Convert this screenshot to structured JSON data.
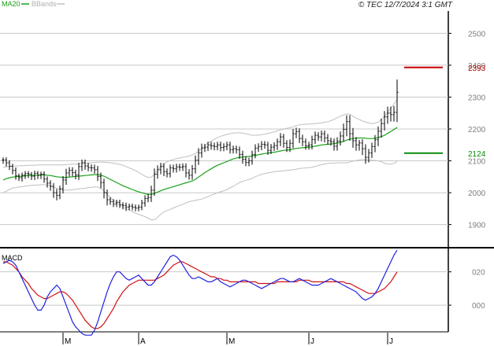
{
  "legend": {
    "ma_label": "MA20",
    "bands_label": "BBands"
  },
  "copyright": "© TEC 12/7/2024 3:1 GMT",
  "macd_title": "MACD",
  "colors": {
    "price_bar": "#000000",
    "ma20": "#1aa01a",
    "bbands": "#c0c0c0",
    "macd_line": "#1f22e0",
    "signal_line": "#d01010",
    "resistance": "#cc0000",
    "support": "#0a8a0a",
    "grid": "#c8c8c8"
  },
  "chart_data": [
    {
      "type": "ohlc",
      "title": "",
      "ylim": [
        1830,
        2570
      ],
      "y_ticks": [
        "2500",
        "2400",
        "2300",
        "2200",
        "2100",
        "2000",
        "1900"
      ],
      "x_labels": [
        "M",
        "A",
        "M",
        "J",
        "J"
      ],
      "x_label_index": [
        19,
        43,
        71,
        97,
        122
      ],
      "levels": [
        {
          "name": "resistance",
          "value": 2393,
          "label": "2393"
        },
        {
          "name": "support",
          "value": 2124,
          "label": "2124"
        }
      ],
      "close": [
        2103,
        2094,
        2083,
        2070,
        2053,
        2047,
        2055,
        2060,
        2058,
        2052,
        2061,
        2055,
        2058,
        2043,
        2030,
        2020,
        2000,
        1992,
        2012,
        2040,
        2062,
        2070,
        2063,
        2056,
        2082,
        2094,
        2084,
        2079,
        2078,
        2072,
        2051,
        2032,
        2000,
        1978,
        1972,
        1965,
        1970,
        1962,
        1960,
        1955,
        1958,
        1955,
        1952,
        1955,
        1968,
        1982,
        1985,
        2008,
        2058,
        2072,
        2082,
        2066,
        2060,
        2078,
        2075,
        2081,
        2080,
        2082,
        2062,
        2055,
        2075,
        2102,
        2125,
        2140,
        2143,
        2150,
        2147,
        2145,
        2150,
        2142,
        2145,
        2150,
        2135,
        2138,
        2135,
        2120,
        2105,
        2095,
        2100,
        2120,
        2140,
        2145,
        2152,
        2150,
        2133,
        2143,
        2148,
        2160,
        2175,
        2155,
        2142,
        2155,
        2185,
        2192,
        2170,
        2160,
        2147,
        2150,
        2167,
        2180,
        2175,
        2185,
        2172,
        2163,
        2160,
        2146,
        2162,
        2178,
        2199,
        2223,
        2185,
        2163,
        2150,
        2156,
        2138,
        2111,
        2125,
        2145,
        2166,
        2193,
        2217,
        2238,
        2250,
        2245,
        2252,
        2315
      ],
      "high_offset": [
        8,
        8,
        8,
        8,
        9,
        7,
        8,
        8,
        8,
        7,
        8,
        7,
        8,
        9,
        8,
        9,
        10,
        12,
        10,
        12,
        13,
        10,
        10,
        9,
        12,
        10,
        10,
        10,
        10,
        10,
        12,
        12,
        12,
        10,
        8,
        8,
        8,
        8,
        8,
        9,
        8,
        8,
        8,
        8,
        10,
        10,
        12,
        14,
        18,
        14,
        12,
        10,
        10,
        10,
        10,
        10,
        10,
        10,
        10,
        12,
        12,
        15,
        15,
        14,
        10,
        10,
        10,
        10,
        10,
        10,
        10,
        10,
        10,
        10,
        10,
        10,
        12,
        10,
        10,
        12,
        12,
        10,
        10,
        10,
        10,
        10,
        10,
        10,
        12,
        10,
        10,
        12,
        15,
        12,
        10,
        12,
        10,
        10,
        12,
        12,
        10,
        10,
        10,
        12,
        10,
        10,
        12,
        14,
        18,
        20,
        20,
        18,
        12,
        10,
        12,
        14,
        12,
        12,
        15,
        15,
        15,
        18,
        20,
        20,
        20,
        40
      ],
      "low_offset": [
        12,
        12,
        12,
        12,
        12,
        10,
        12,
        12,
        12,
        12,
        12,
        12,
        12,
        12,
        14,
        14,
        16,
        16,
        12,
        14,
        15,
        12,
        12,
        14,
        16,
        14,
        12,
        12,
        12,
        12,
        14,
        18,
        18,
        18,
        10,
        10,
        10,
        10,
        12,
        12,
        10,
        10,
        10,
        10,
        10,
        12,
        12,
        14,
        18,
        14,
        14,
        14,
        12,
        12,
        12,
        12,
        12,
        12,
        14,
        14,
        14,
        15,
        15,
        15,
        12,
        12,
        12,
        12,
        12,
        12,
        12,
        12,
        12,
        12,
        12,
        14,
        14,
        12,
        12,
        12,
        12,
        12,
        12,
        12,
        14,
        12,
        12,
        14,
        14,
        14,
        14,
        14,
        15,
        14,
        14,
        14,
        12,
        12,
        14,
        14,
        12,
        14,
        14,
        12,
        12,
        14,
        14,
        14,
        18,
        22,
        22,
        22,
        18,
        18,
        20,
        20,
        16,
        16,
        18,
        20,
        20,
        22,
        22,
        22,
        22,
        30
      ],
      "ma20": [
        2040,
        2044,
        2047,
        2049,
        2050,
        2051,
        2052,
        2053,
        2054,
        2054,
        2055,
        2055,
        2056,
        2056,
        2055,
        2054,
        2052,
        2050,
        2049,
        2048,
        2048,
        2049,
        2050,
        2051,
        2052,
        2053,
        2054,
        2055,
        2056,
        2057,
        2057,
        2055,
        2052,
        2047,
        2042,
        2037,
        2032,
        2027,
        2022,
        2018,
        2014,
        2010,
        2006,
        2003,
        2000,
        1997,
        1995,
        1995,
        1998,
        2002,
        2006,
        2010,
        2013,
        2016,
        2019,
        2022,
        2025,
        2028,
        2031,
        2034,
        2037,
        2042,
        2049,
        2056,
        2063,
        2069,
        2075,
        2081,
        2086,
        2090,
        2094,
        2098,
        2102,
        2106,
        2109,
        2111,
        2112,
        2113,
        2114,
        2115,
        2117,
        2119,
        2121,
        2123,
        2124,
        2126,
        2127,
        2129,
        2131,
        2133,
        2134,
        2135,
        2137,
        2139,
        2140,
        2141,
        2142,
        2143,
        2144,
        2146,
        2148,
        2150,
        2151,
        2152,
        2153,
        2154,
        2156,
        2158,
        2161,
        2165,
        2168,
        2170,
        2171,
        2172,
        2172,
        2171,
        2170,
        2170,
        2171,
        2173,
        2176,
        2180,
        2186,
        2192,
        2198,
        2205
      ],
      "bb_upper": [
        2080,
        2081,
        2082,
        2083,
        2084,
        2084,
        2085,
        2085,
        2086,
        2086,
        2086,
        2087,
        2087,
        2087,
        2087,
        2087,
        2087,
        2087,
        2087,
        2087,
        2088,
        2089,
        2090,
        2090,
        2091,
        2092,
        2093,
        2093,
        2094,
        2095,
        2096,
        2096,
        2096,
        2095,
        2094,
        2093,
        2091,
        2089,
        2086,
        2082,
        2078,
        2074,
        2069,
        2064,
        2058,
        2052,
        2048,
        2049,
        2057,
        2070,
        2082,
        2091,
        2097,
        2101,
        2104,
        2107,
        2109,
        2111,
        2113,
        2115,
        2118,
        2123,
        2130,
        2139,
        2148,
        2156,
        2162,
        2168,
        2173,
        2177,
        2180,
        2183,
        2185,
        2187,
        2188,
        2188,
        2187,
        2185,
        2183,
        2180,
        2180,
        2181,
        2182,
        2184,
        2186,
        2188,
        2191,
        2194,
        2197,
        2200,
        2202,
        2204,
        2207,
        2210,
        2213,
        2214,
        2215,
        2215,
        2216,
        2217,
        2218,
        2219,
        2221,
        2223,
        2226,
        2230,
        2235,
        2240,
        2244,
        2247,
        2246,
        2240,
        2234,
        2230,
        2225,
        2222,
        2219,
        2217,
        2218,
        2222,
        2230,
        2240,
        2252,
        2265,
        2278,
        2292
      ],
      "bb_lower": [
        2000,
        2005,
        2010,
        2015,
        2016,
        2018,
        2019,
        2021,
        2022,
        2023,
        2024,
        2024,
        2025,
        2025,
        2024,
        2022,
        2018,
        2014,
        2011,
        2009,
        2008,
        2008,
        2009,
        2011,
        2012,
        2013,
        2014,
        2016,
        2017,
        2018,
        2018,
        2013,
        2006,
        1995,
        1985,
        1976,
        1969,
        1962,
        1955,
        1950,
        1946,
        1941,
        1936,
        1932,
        1929,
        1925,
        1920,
        1915,
        1915,
        1923,
        1932,
        1940,
        1944,
        1948,
        1952,
        1956,
        1960,
        1964,
        1968,
        1972,
        1974,
        1976,
        1978,
        1980,
        1984,
        1988,
        1992,
        1996,
        2000,
        2003,
        2006,
        2010,
        2015,
        2020,
        2026,
        2032,
        2036,
        2039,
        2042,
        2045,
        2050,
        2054,
        2058,
        2060,
        2062,
        2064,
        2066,
        2067,
        2068,
        2069,
        2070,
        2071,
        2072,
        2074,
        2076,
        2077,
        2078,
        2079,
        2080,
        2082,
        2085,
        2088,
        2090,
        2092,
        2093,
        2093,
        2094,
        2094,
        2094,
        2094,
        2096,
        2099,
        2101,
        2103,
        2104,
        2104,
        2103,
        2102,
        2101,
        2100,
        2097,
        2093,
        2090,
        2090,
        2092,
        2098
      ]
    },
    {
      "type": "line",
      "title": "MACD",
      "ylim": [
        -16,
        34
      ],
      "y_ticks": [
        "020",
        "000"
      ],
      "series": [
        {
          "name": "MACD",
          "values": [
            25,
            26,
            27,
            26,
            24,
            20,
            16,
            12,
            8,
            4,
            0,
            -3,
            -3,
            0,
            5,
            8,
            10,
            12,
            10,
            5,
            0,
            -5,
            -10,
            -13,
            -15,
            -17,
            -18,
            -18,
            -18,
            -15,
            -10,
            -4,
            2,
            8,
            13,
            17,
            20,
            20,
            18,
            16,
            15,
            16,
            17,
            18,
            16,
            14,
            12,
            12,
            14,
            17,
            20,
            23,
            26,
            29,
            30,
            29,
            27,
            24,
            21,
            18,
            16,
            16,
            17,
            16,
            15,
            14,
            14,
            15,
            16,
            14,
            13,
            12,
            11,
            12,
            13,
            14,
            15,
            15,
            14,
            13,
            12,
            11,
            10,
            11,
            12,
            13,
            14,
            15,
            16,
            16,
            15,
            14,
            14,
            15,
            16,
            15,
            14,
            13,
            12,
            12,
            12,
            13,
            14,
            15,
            16,
            15,
            14,
            13,
            12,
            11,
            10,
            9,
            8,
            6,
            4,
            3,
            4,
            5,
            7,
            10,
            14,
            18,
            22,
            26,
            30,
            33
          ]
        },
        {
          "name": "Signal",
          "values": [
            26,
            26,
            25,
            24,
            22,
            20,
            17,
            15,
            13,
            10,
            8,
            6,
            5,
            4,
            4,
            5,
            6,
            7,
            8,
            8,
            7,
            5,
            3,
            0,
            -3,
            -6,
            -9,
            -11,
            -13,
            -14,
            -14,
            -13,
            -11,
            -8,
            -5,
            -2,
            2,
            5,
            8,
            10,
            12,
            13,
            14,
            15,
            15,
            15,
            15,
            15,
            15,
            16,
            17,
            18,
            20,
            22,
            24,
            25,
            26,
            26,
            25,
            24,
            23,
            22,
            21,
            20,
            19,
            18,
            17,
            17,
            16,
            16,
            15,
            15,
            14,
            14,
            14,
            14,
            14,
            14,
            14,
            14,
            14,
            13,
            13,
            13,
            13,
            13,
            13,
            14,
            14,
            14,
            14,
            14,
            14,
            14,
            15,
            15,
            15,
            15,
            14,
            14,
            14,
            14,
            14,
            14,
            14,
            14,
            14,
            14,
            14,
            13,
            13,
            12,
            11,
            10,
            9,
            8,
            7,
            7,
            7,
            8,
            9,
            10,
            12,
            14,
            17,
            20
          ]
        }
      ]
    }
  ]
}
